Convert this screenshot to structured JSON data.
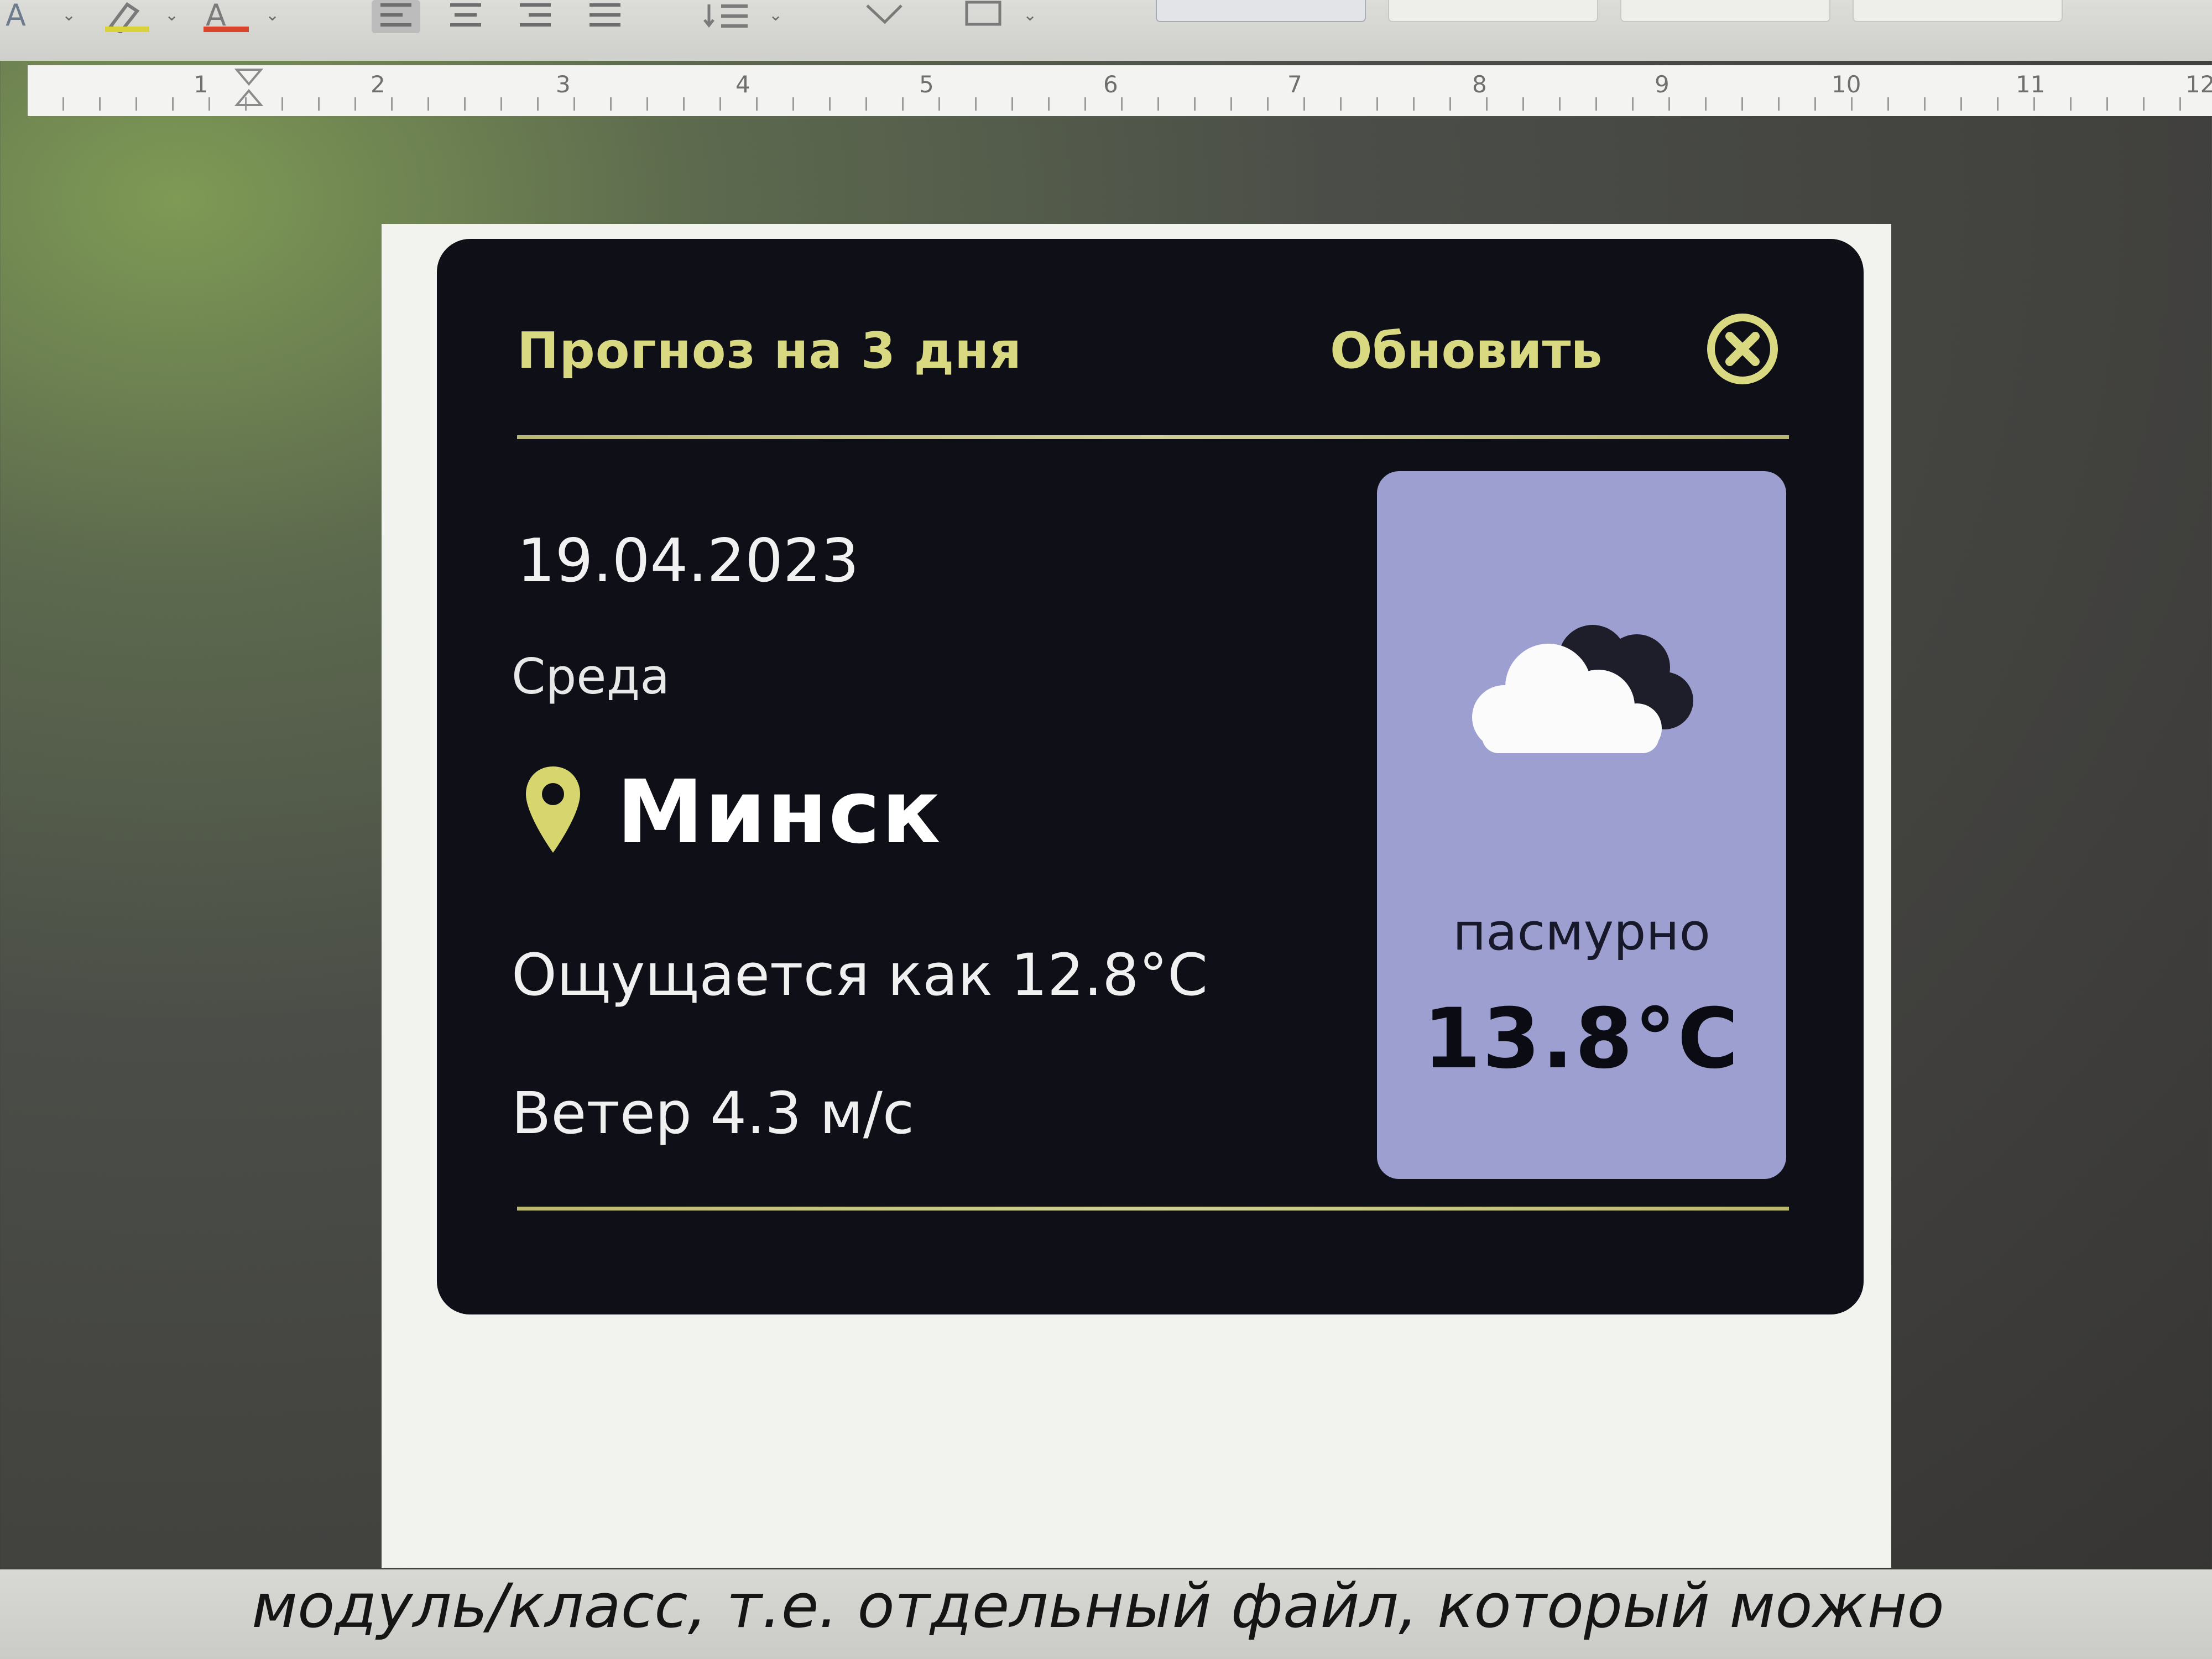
{
  "toolbar": {
    "font_color_icon": "font-color-icon",
    "highlight_icon": "highlight-pen-icon",
    "text_color_icon": "text-color-icon",
    "highlight_color": "#d9d23a",
    "text_color": "#d8452c"
  },
  "ruler": {
    "numbers": [
      "1",
      "2",
      "3",
      "4",
      "5",
      "6",
      "7",
      "8",
      "9",
      "10",
      "11",
      "12"
    ]
  },
  "widget": {
    "title": "Прогноз на 3 дня",
    "refresh_label": "Обновить",
    "close_icon": "close-circle-icon",
    "date": "19.04.2023",
    "weekday": "Среда",
    "location_icon": "map-pin-icon",
    "city": "Минск",
    "feels_like": "Ощущается как 12.8°С",
    "wind": "Ветер 4.3 м/с",
    "condition_icon": "cloudy-icon",
    "condition": "пасмурно",
    "temperature": "13.8°С",
    "colors": {
      "background": "#0e0f17",
      "accent": "#d9d982",
      "card": "#9d9fd0"
    }
  },
  "document": {
    "text_line": "модуль/класс, т.е. отдельный файл, который можно"
  }
}
